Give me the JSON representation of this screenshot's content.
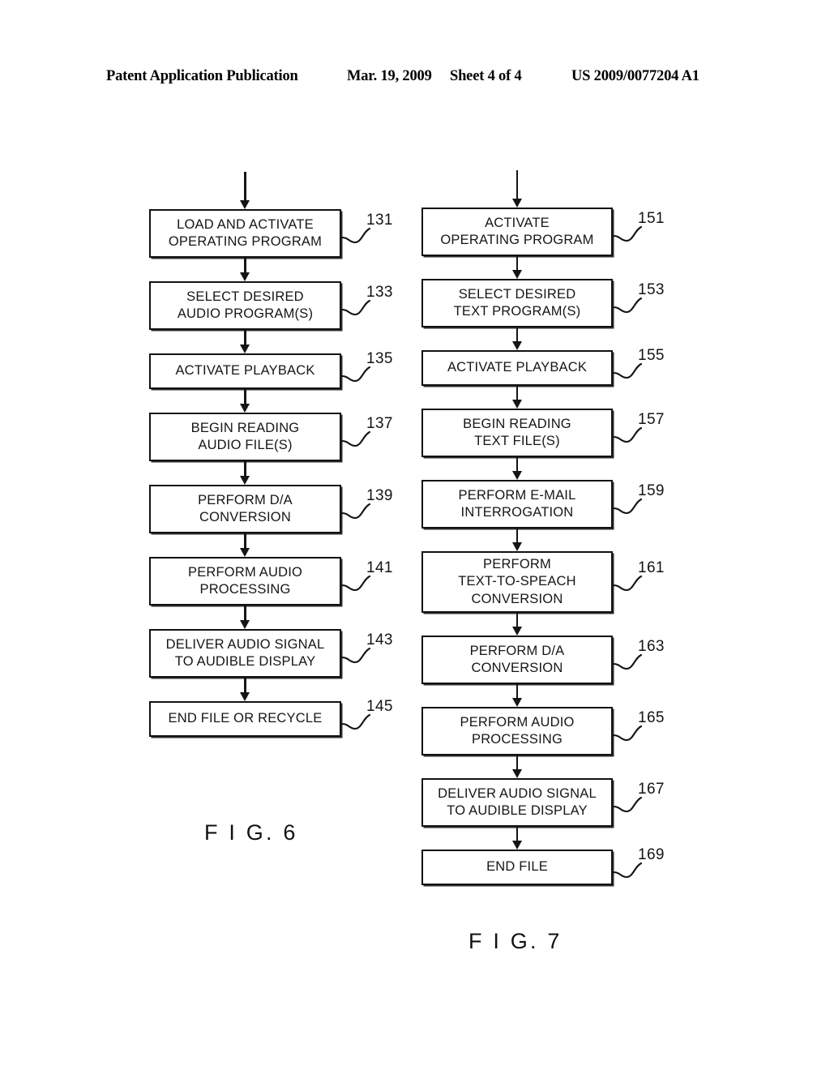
{
  "header": {
    "publication": "Patent Application Publication",
    "date": "Mar. 19, 2009",
    "sheet": "Sheet 4 of 4",
    "patent_number": "US 2009/0077204 A1"
  },
  "figures": [
    {
      "caption": "F I G. 6",
      "column": "left",
      "steps": [
        {
          "ref": "131",
          "label": "LOAD AND ACTIVATE\nOPERATING PROGRAM",
          "lines": 2
        },
        {
          "ref": "133",
          "label": "SELECT DESIRED\nAUDIO PROGRAM(S)",
          "lines": 2
        },
        {
          "ref": "135",
          "label": "ACTIVATE PLAYBACK",
          "lines": 1
        },
        {
          "ref": "137",
          "label": "BEGIN READING\nAUDIO FILE(S)",
          "lines": 2
        },
        {
          "ref": "139",
          "label": "PERFORM D/A\nCONVERSION",
          "lines": 2
        },
        {
          "ref": "141",
          "label": "PERFORM AUDIO\nPROCESSING",
          "lines": 2
        },
        {
          "ref": "143",
          "label": "DELIVER AUDIO SIGNAL\nTO AUDIBLE DISPLAY",
          "lines": 2
        },
        {
          "ref": "145",
          "label": "END FILE OR RECYCLE",
          "lines": 1
        }
      ]
    },
    {
      "caption": "F I G. 7",
      "column": "right",
      "steps": [
        {
          "ref": "151",
          "label": "ACTIVATE\nOPERATING PROGRAM",
          "lines": 2
        },
        {
          "ref": "153",
          "label": "SELECT DESIRED\nTEXT PROGRAM(S)",
          "lines": 2
        },
        {
          "ref": "155",
          "label": "ACTIVATE PLAYBACK",
          "lines": 1
        },
        {
          "ref": "157",
          "label": "BEGIN READING\nTEXT FILE(S)",
          "lines": 2
        },
        {
          "ref": "159",
          "label": "PERFORM E-MAIL\nINTERROGATION",
          "lines": 2
        },
        {
          "ref": "161",
          "label": "PERFORM\nTEXT-TO-SPEACH\nCONVERSION",
          "lines": 3
        },
        {
          "ref": "163",
          "label": "PERFORM D/A\nCONVERSION",
          "lines": 2
        },
        {
          "ref": "165",
          "label": "PERFORM AUDIO\nPROCESSING",
          "lines": 2
        },
        {
          "ref": "167",
          "label": "DELIVER AUDIO SIGNAL\nTO AUDIBLE DISPLAY",
          "lines": 2
        },
        {
          "ref": "169",
          "label": "END FILE",
          "lines": 1
        }
      ]
    }
  ]
}
